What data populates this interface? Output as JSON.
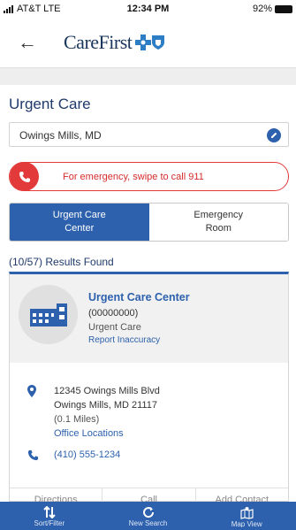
{
  "status_bar": {
    "carrier": "AT&T  LTE",
    "time": "12:34 PM",
    "battery": "92%"
  },
  "header": {
    "logo_text": "CareFirst"
  },
  "page": {
    "title": "Urgent Care"
  },
  "location": {
    "value": "Owings Mills, MD"
  },
  "emergency": {
    "text": "For emergency, swipe to call 911",
    "color": "#e23a3a"
  },
  "toggle": {
    "options": [
      {
        "label_line1": "Urgent Care",
        "label_line2": "Center",
        "active": true
      },
      {
        "label_line1": "Emergency",
        "label_line2": "Room",
        "active": false
      }
    ]
  },
  "results": {
    "text": "(10/57) Results Found"
  },
  "card": {
    "name": "Urgent Care Center",
    "id": "(00000000)",
    "type": "Urgent Care",
    "report": "Report Inaccuracy",
    "address_line1": "12345 Owings Mills Blvd",
    "address_line2": "Owings Mills, MD 21117",
    "distance": "(0.1 Miles)",
    "office_locations": "Office Locations",
    "phone": "(410) 555-1234",
    "actions": [
      "Directions",
      "Call",
      "Add Contact"
    ]
  },
  "bottom_bar": {
    "buttons": [
      {
        "icon": "sort-icon",
        "label": "Sort/Filter"
      },
      {
        "icon": "refresh-icon",
        "label": "New Search"
      },
      {
        "icon": "map-icon",
        "label": "Map View"
      }
    ]
  },
  "colors": {
    "primary": "#2d61ad",
    "brand_navy": "#1b365d",
    "alert_red": "#e23a3a"
  }
}
